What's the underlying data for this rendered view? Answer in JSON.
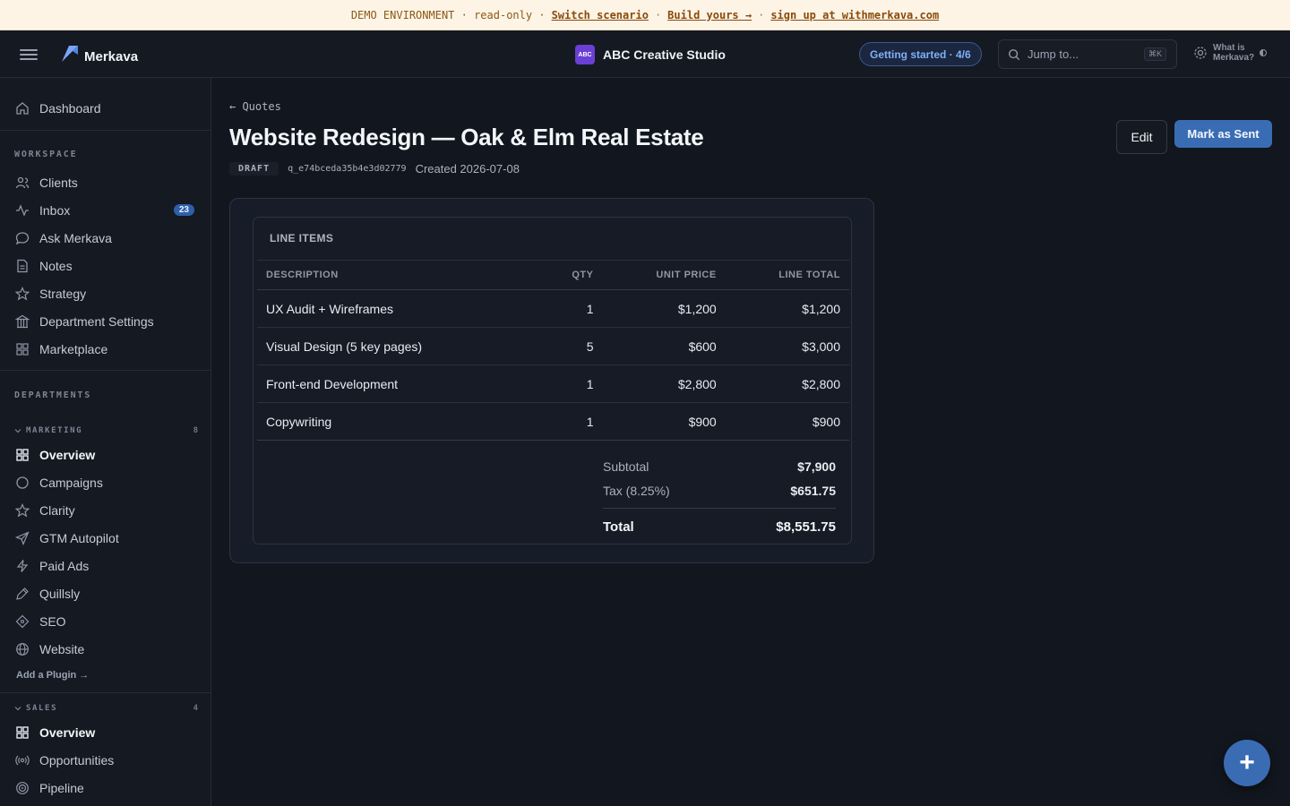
{
  "banner": {
    "env_text": "DEMO ENVIRONMENT · read-only ·",
    "switch_label": "Switch scenario",
    "build_label": "Build yours →",
    "signup_label": "sign up at withmerkava.com",
    "dot": "·"
  },
  "topbar": {
    "brand": "Merkava",
    "org_badge": "ABC",
    "org_name": "ABC Creative Studio",
    "getting_started": "Getting started · 4/6",
    "search_placeholder": "Jump to...",
    "search_shortcut": "⌘K",
    "whatis_line1": "What is",
    "whatis_line2": "Merkava?"
  },
  "sidebar": {
    "dashboard": "Dashboard",
    "workspace_label": "WORKSPACE",
    "workspace": [
      {
        "label": "Clients",
        "icon": "users-icon"
      },
      {
        "label": "Inbox",
        "icon": "activity-icon",
        "count": "23"
      },
      {
        "label": "Ask Merkava",
        "icon": "chat-icon"
      },
      {
        "label": "Notes",
        "icon": "document-icon"
      },
      {
        "label": "Strategy",
        "icon": "star-icon"
      },
      {
        "label": "Department Settings",
        "icon": "building-icon"
      },
      {
        "label": "Marketplace",
        "icon": "grid-icon"
      }
    ],
    "departments_label": "DEPARTMENTS",
    "marketing": {
      "label": "MARKETING",
      "count": "8",
      "items": [
        {
          "label": "Overview",
          "icon": "grid-icon",
          "active": true
        },
        {
          "label": "Campaigns",
          "icon": "circle-icon"
        },
        {
          "label": "Clarity",
          "icon": "star-icon"
        },
        {
          "label": "GTM Autopilot",
          "icon": "send-icon"
        },
        {
          "label": "Paid Ads",
          "icon": "zap-icon"
        },
        {
          "label": "Quillsly",
          "icon": "pen-icon"
        },
        {
          "label": "SEO",
          "icon": "diamond-icon"
        },
        {
          "label": "Website",
          "icon": "globe-icon"
        }
      ],
      "add_plugin": "Add a Plugin →"
    },
    "sales": {
      "label": "SALES",
      "count": "4",
      "items": [
        {
          "label": "Overview",
          "icon": "grid-icon",
          "active": true
        },
        {
          "label": "Opportunities",
          "icon": "radio-icon"
        },
        {
          "label": "Pipeline",
          "icon": "target-icon"
        }
      ]
    }
  },
  "main": {
    "back_label": "← Quotes",
    "title": "Website Redesign — Oak & Elm Real Estate",
    "status": "DRAFT",
    "quote_id": "q_e74bceda35b4e3d02779",
    "created": "Created 2026-07-08",
    "edit_label": "Edit",
    "mark_sent_label": "Mark as Sent"
  },
  "line_items": {
    "title": "LINE ITEMS",
    "headers": {
      "description": "DESCRIPTION",
      "qty": "QTY",
      "unit_price": "UNIT PRICE",
      "line_total": "LINE TOTAL"
    },
    "rows": [
      {
        "description": "UX Audit + Wireframes",
        "qty": "1",
        "unit_price": "$1,200",
        "line_total": "$1,200"
      },
      {
        "description": "Visual Design (5 key pages)",
        "qty": "5",
        "unit_price": "$600",
        "line_total": "$3,000"
      },
      {
        "description": "Front-end Development",
        "qty": "1",
        "unit_price": "$2,800",
        "line_total": "$2,800"
      },
      {
        "description": "Copywriting",
        "qty": "1",
        "unit_price": "$900",
        "line_total": "$900"
      }
    ],
    "subtotal_label": "Subtotal",
    "subtotal": "$7,900",
    "tax_label": "Tax (8.25%)",
    "tax": "$651.75",
    "total_label": "Total",
    "total": "$8,551.75"
  },
  "fab_label": "+",
  "colors": {
    "accent": "#3a6cb4",
    "background": "#12161e",
    "banner": "#fdf4e6",
    "org_badge": "#6b3fd6"
  }
}
